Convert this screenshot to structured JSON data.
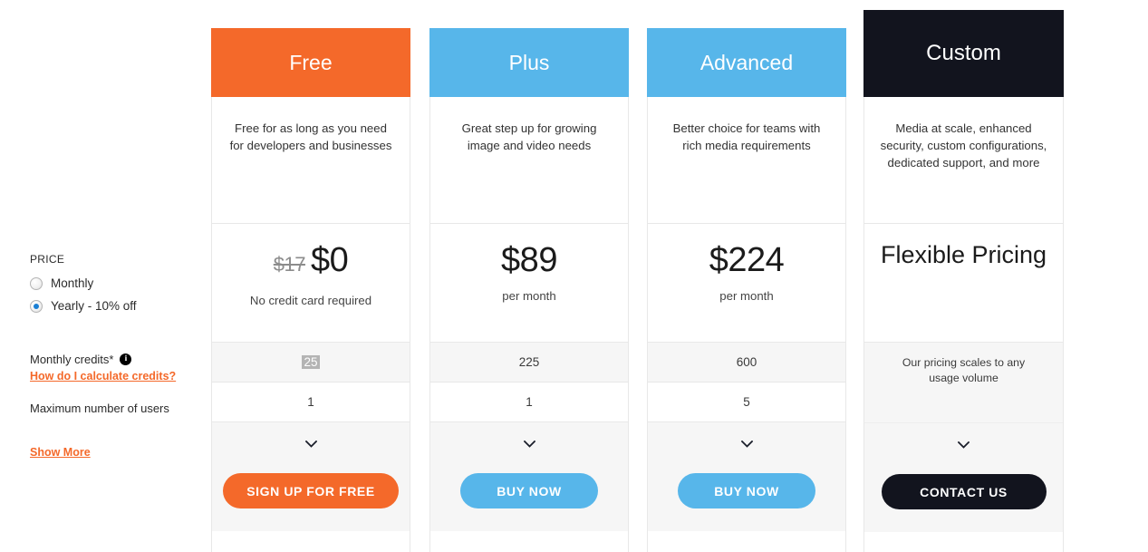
{
  "sidebar": {
    "price_label": "PRICE",
    "billing_options": [
      {
        "label": "Monthly",
        "selected": false
      },
      {
        "label": "Yearly - 10% off",
        "selected": true
      }
    ],
    "feature_rows": [
      {
        "label": "Monthly credits*",
        "has_info_icon": true
      },
      {
        "label": "Maximum number of users",
        "has_info_icon": false
      }
    ],
    "calculate_credits_link": "How do I calculate credits?",
    "show_more_link": "Show More",
    "info_icon_glyph": "i"
  },
  "colors": {
    "orange": "#F4692A",
    "blue": "#57B6EA",
    "dark": "#12141E",
    "shaded_row": "#f6f6f6",
    "border": "#e8e8e8"
  },
  "plans": [
    {
      "name": "Free",
      "header_color": "#F4692A",
      "description": "Free for as long as you need for developers and businesses",
      "price_old": "$17",
      "price": "$0",
      "price_sub": "No credit card required",
      "monthly_credits": "25",
      "credits_selected": true,
      "max_users": "1",
      "cta_label": "SIGN UP FOR FREE",
      "cta_color": "#F4692A"
    },
    {
      "name": "Plus",
      "header_color": "#57B6EA",
      "description": "Great step up for growing image and video needs",
      "price_old": "",
      "price": "$89",
      "price_sub": "per month",
      "monthly_credits": "225",
      "credits_selected": false,
      "max_users": "1",
      "cta_label": "BUY NOW",
      "cta_color": "#57B6EA"
    },
    {
      "name": "Advanced",
      "header_color": "#57B6EA",
      "description": "Better choice for teams with rich media requirements",
      "price_old": "",
      "price": "$224",
      "price_sub": "per month",
      "monthly_credits": "600",
      "credits_selected": false,
      "max_users": "5",
      "cta_label": "BUY NOW",
      "cta_color": "#57B6EA"
    },
    {
      "name": "Custom",
      "header_color": "#12141E",
      "description": "Media at scale, enhanced security, custom configurations, dedicated support, and more",
      "price_old": "",
      "price": "Flexible Pricing",
      "price_sub": "",
      "merged_note": "Our pricing scales to any usage volume",
      "cta_label": "CONTACT US",
      "cta_color": "#12141E"
    }
  ]
}
